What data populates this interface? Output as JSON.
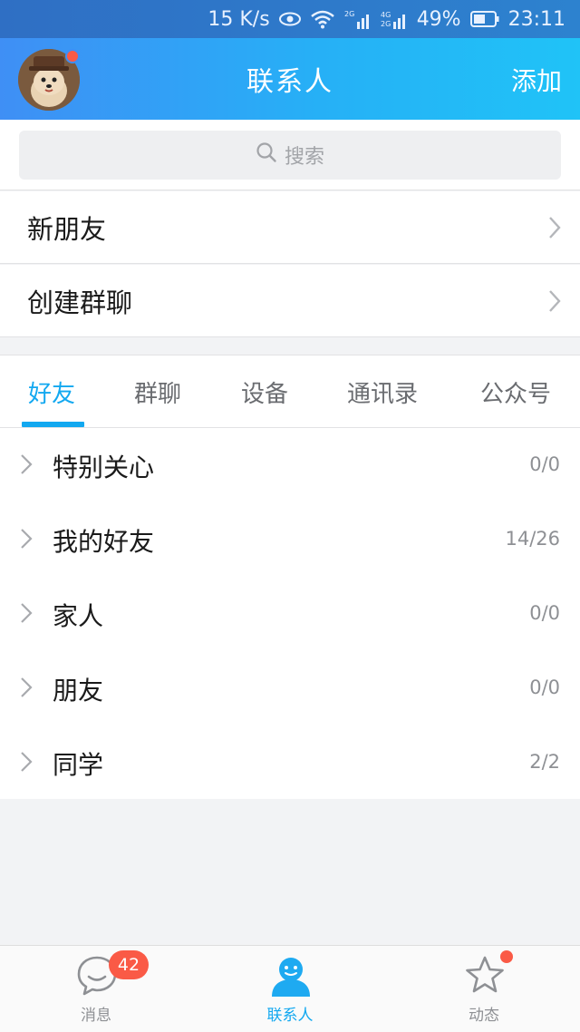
{
  "status_bar": {
    "speed": "15 K/s",
    "battery": "49%",
    "time": "23:11"
  },
  "header": {
    "title": "联系人",
    "add_label": "添加"
  },
  "search": {
    "placeholder": "搜索"
  },
  "menu": {
    "new_friends": "新朋友",
    "create_group": "创建群聊"
  },
  "tabs": [
    {
      "label": "好友",
      "active": true
    },
    {
      "label": "群聊",
      "active": false
    },
    {
      "label": "设备",
      "active": false
    },
    {
      "label": "通讯录",
      "active": false
    },
    {
      "label": "公众号",
      "active": false
    }
  ],
  "groups": [
    {
      "name": "特别关心",
      "count": "0/0"
    },
    {
      "name": "我的好友",
      "count": "14/26"
    },
    {
      "name": "家人",
      "count": "0/0"
    },
    {
      "name": "朋友",
      "count": "0/0"
    },
    {
      "name": "同学",
      "count": "2/2"
    }
  ],
  "bottom_nav": [
    {
      "label": "消息",
      "icon": "chat-bubble-icon",
      "active": false
    },
    {
      "label": "联系人",
      "icon": "contacts-person-icon",
      "active": true
    },
    {
      "label": "动态",
      "icon": "star-icon",
      "active": false
    }
  ],
  "messages_badge": "42",
  "colors": {
    "accent": "#12a8f0",
    "header_gradient_start": "#3f8ff5",
    "header_gradient_end": "#20c3f7",
    "badge": "#fa5a46"
  }
}
